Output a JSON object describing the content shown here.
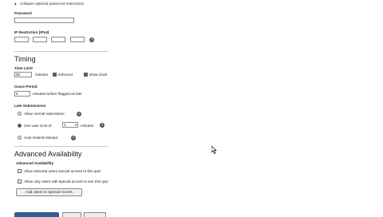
{
  "restrictions": {
    "collapse_link": "Collapse optional advanced restrictions",
    "password_label": "Password",
    "ip_label": "IP Restriction (IPv4)"
  },
  "timing": {
    "heading": "Timing",
    "time_limit_label": "Time Limit",
    "time_limit_value": "90",
    "minutes_label": "minutes",
    "enforced_label": "enforced",
    "show_clock_label": "show clock",
    "grace_label": "Grace Period",
    "grace_value": "5",
    "grace_suffix": "minutes before flagged as late",
    "late_label": "Late Submissions",
    "allow_normal": "Allow normal submission",
    "use_late_limit": "Use Late Limit of",
    "late_limit_value": "1",
    "late_limit_suffix": "minutes",
    "auto_submit": "Auto-Submit Attempt"
  },
  "availability": {
    "heading": "Advanced Availability",
    "sub_label": "Advanced Availability",
    "option1": "Allow selected users special access to this quiz",
    "option2": "Allow only users with special access to see this quiz",
    "add_button": "Add Users to Special Access"
  }
}
